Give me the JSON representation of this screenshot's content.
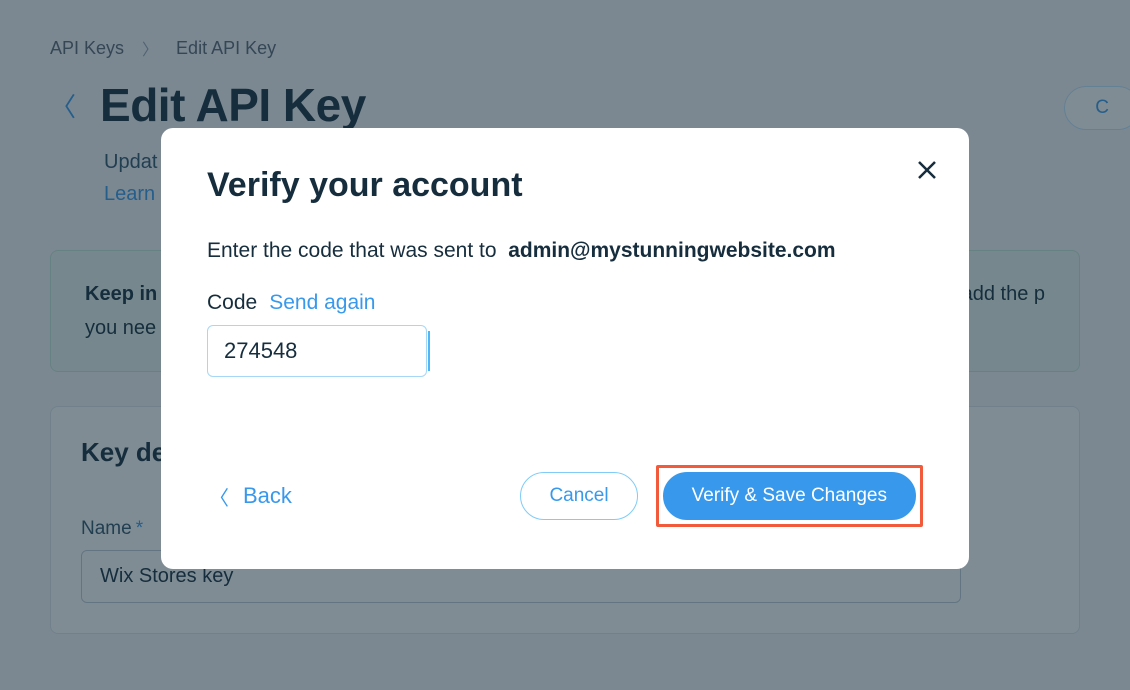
{
  "breadcrumb": {
    "root": "API Keys",
    "current": "Edit API Key"
  },
  "page": {
    "title": "Edit API Key",
    "subtitle_prefix": "Updat",
    "learn_label": "Learn",
    "cancel_label": "C"
  },
  "notice": {
    "strong": "Keep in",
    "line1_suffix": "y add the p",
    "line2": "you nee"
  },
  "section": {
    "title": "Key de",
    "name_label": "Name",
    "name_value": "Wix Stores key"
  },
  "modal": {
    "title": "Verify your account",
    "instruction_prefix": "Enter the code that was sent to",
    "email": "admin@mystunningwebsite.com",
    "code_label": "Code",
    "send_again": "Send again",
    "code_value": "274548",
    "back_label": "Back",
    "cancel_label": "Cancel",
    "verify_label": "Verify & Save Changes"
  }
}
